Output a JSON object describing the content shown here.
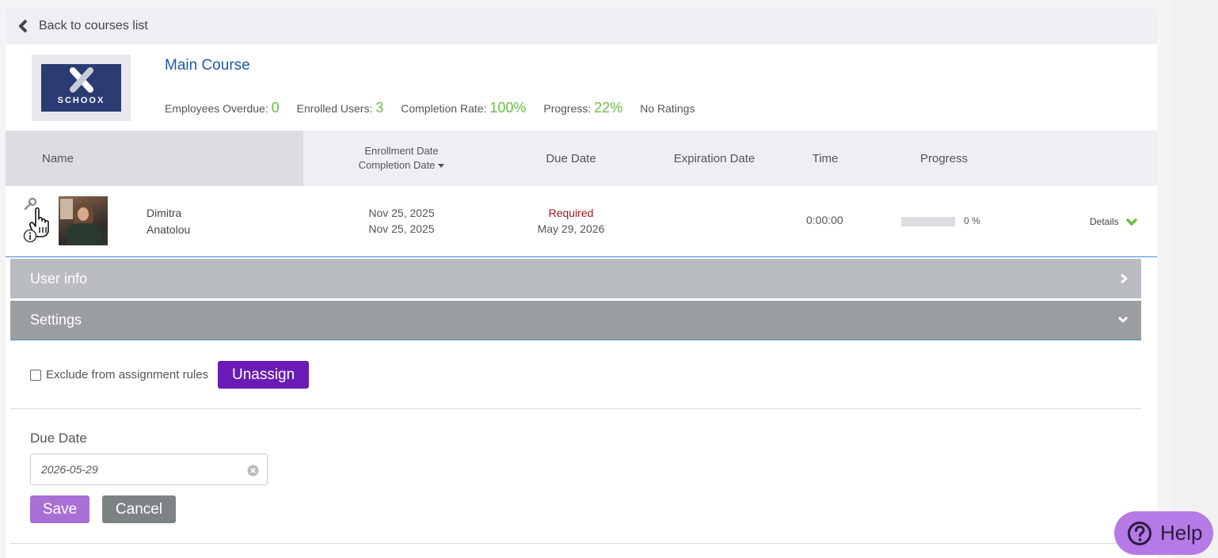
{
  "nav": {
    "back_label": "Back to courses list"
  },
  "course": {
    "logo_text": "SCHOOX",
    "title": "Main Course",
    "stats": {
      "overdue_label": "Employees Overdue:",
      "overdue_value": "0",
      "enrolled_label": "Enrolled Users:",
      "enrolled_value": "3",
      "completion_label": "Completion Rate:",
      "completion_value": "100%",
      "progress_label": "Progress:",
      "progress_value": "22%",
      "ratings": "No Ratings"
    }
  },
  "table": {
    "headers": {
      "name": "Name",
      "enrollment": "Enrollment Date",
      "completion": "Completion Date",
      "due": "Due Date",
      "expiration": "Expiration Date",
      "time": "Time",
      "progress": "Progress"
    },
    "row": {
      "first_name": "Dimitra",
      "last_name": "Anatolou",
      "enrollment_date": "Nov 25, 2025",
      "completion_date": "Nov 25, 2025",
      "due_status": "Required",
      "due_date": "May 29, 2026",
      "time": "0:00:00",
      "progress_text": "0 %",
      "progress_fraction": 0,
      "details_label": "Details"
    }
  },
  "accordion": {
    "user_info": "User info",
    "settings": "Settings"
  },
  "settings": {
    "exclude_label": "Exclude from assignment rules",
    "exclude_checked": false,
    "unassign_label": "Unassign",
    "due_date_label": "Due Date",
    "due_date_value": "2026-05-29",
    "save_label": "Save",
    "cancel_label": "Cancel"
  },
  "help": {
    "label": "Help"
  },
  "colors": {
    "accent_green": "#6bbd45",
    "title_blue": "#1f5aa6",
    "unassign_purple": "#6a1bb5",
    "save_purple": "#a86fd6",
    "help_purple": "#b57ae6",
    "required_red": "#a01818"
  }
}
